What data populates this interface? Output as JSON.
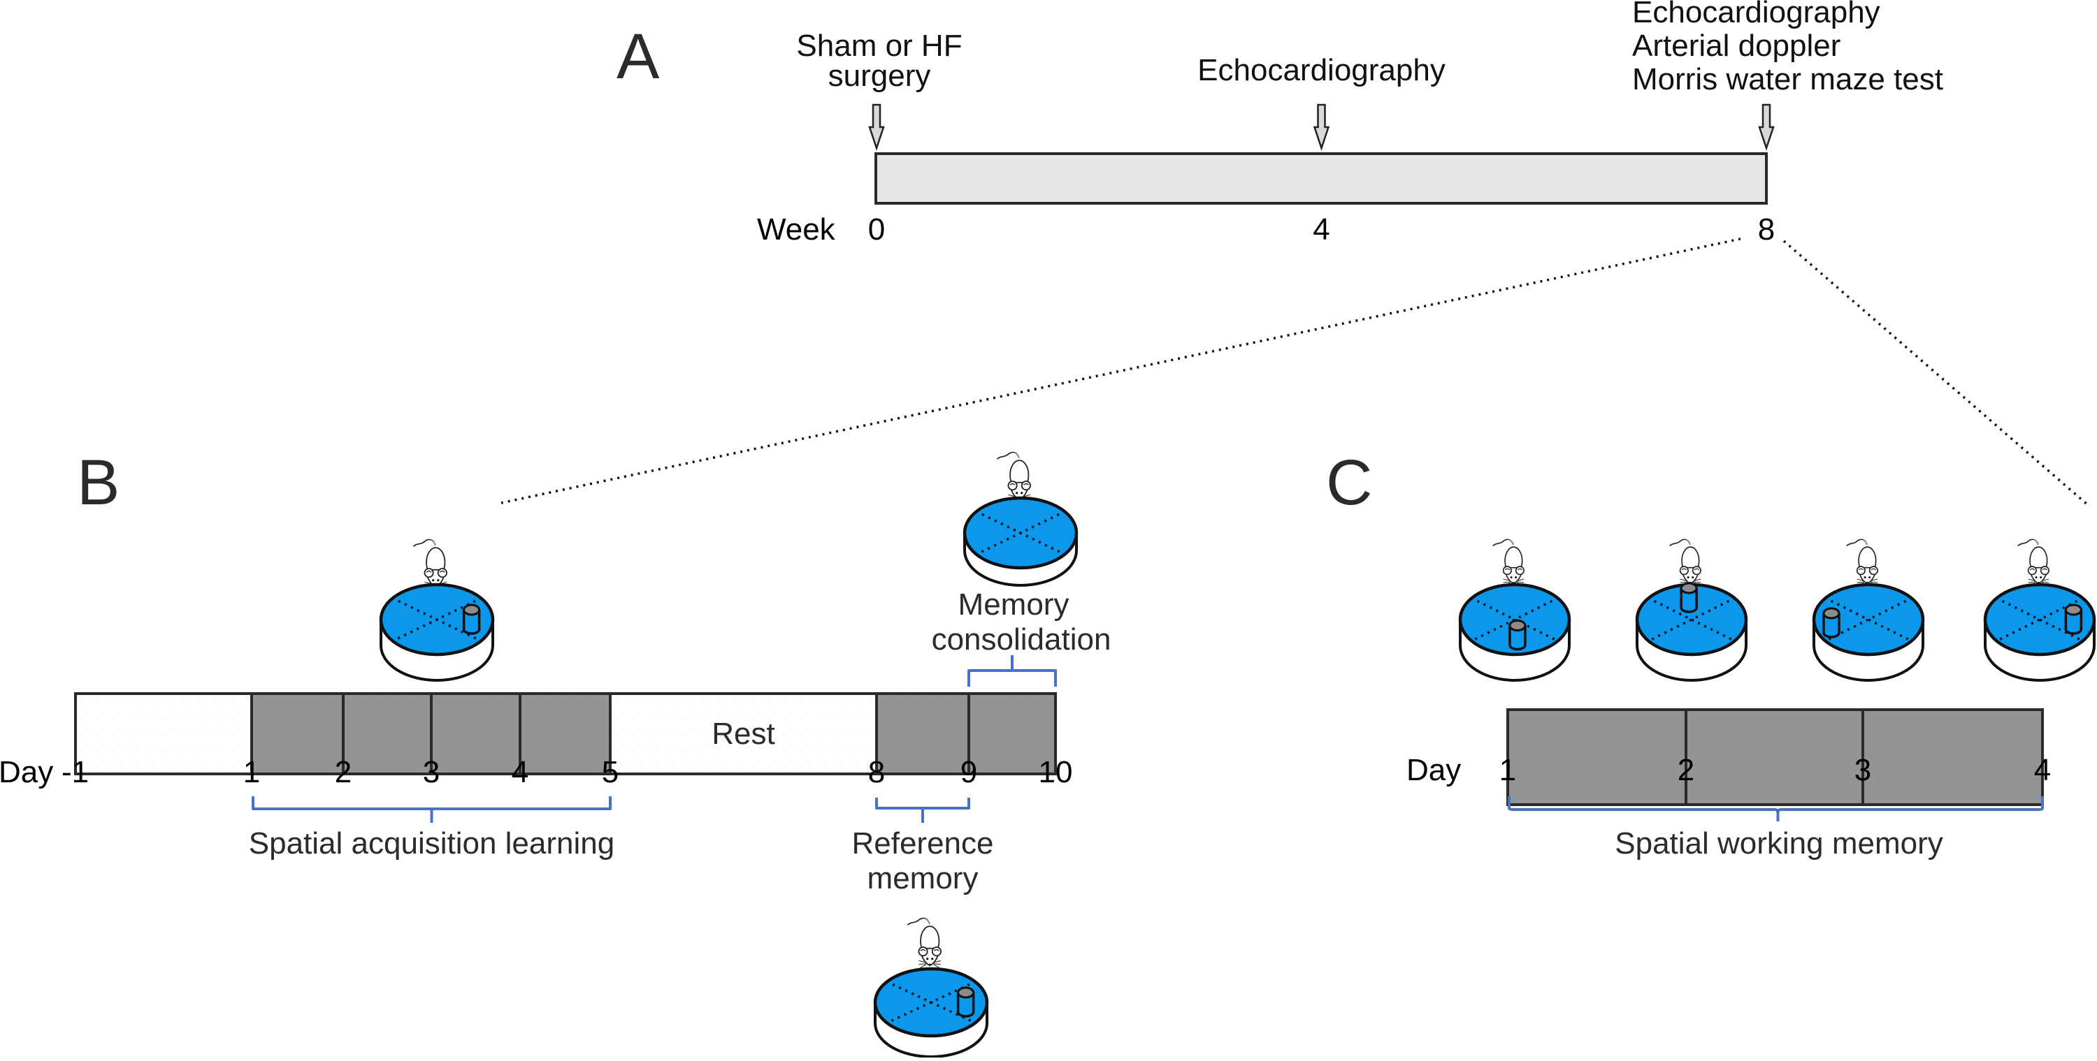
{
  "colors": {
    "pool_water": "#0a97ec",
    "platform_top": "#8c8c8c",
    "bar_timeline": "#e6e7e9",
    "bar_active": "#939495",
    "bar_rest": "#ffffff",
    "bracket": "#4a72c4",
    "arrow_fill": "#d9d9d9"
  },
  "panelA": {
    "letter": "A",
    "axis_label": "Week",
    "ticks": [
      "0",
      "4",
      "8"
    ],
    "events": [
      {
        "week": 0,
        "lines": [
          "Sham or HF",
          "surgery"
        ]
      },
      {
        "week": 4,
        "lines": [
          "Echocardiography"
        ]
      },
      {
        "week": 8,
        "lines": [
          "Echocardiography",
          "Arterial doppler",
          "Morris water maze test"
        ]
      }
    ]
  },
  "panelB": {
    "letter": "B",
    "axis_label": "Day",
    "ticks": [
      "-1",
      "1",
      "2",
      "3",
      "4",
      "5",
      "8",
      "9",
      "10"
    ],
    "segments": [
      {
        "from": "-1",
        "to": "1",
        "kind": "rest",
        "label": ""
      },
      {
        "from": "1",
        "to": "2",
        "kind": "active",
        "label": ""
      },
      {
        "from": "2",
        "to": "3",
        "kind": "active",
        "label": ""
      },
      {
        "from": "3",
        "to": "4",
        "kind": "active",
        "label": ""
      },
      {
        "from": "4",
        "to": "5",
        "kind": "active",
        "label": ""
      },
      {
        "from": "5",
        "to": "8",
        "kind": "rest",
        "label": "Rest"
      },
      {
        "from": "8",
        "to": "9",
        "kind": "active",
        "label": ""
      },
      {
        "from": "9",
        "to": "10",
        "kind": "active",
        "label": ""
      }
    ],
    "rest_label": "Rest",
    "brackets": [
      {
        "name": "spatial-acquisition-learning",
        "from": "1",
        "to": "5",
        "position": "below",
        "lines": [
          "Spatial acquisition learning"
        ]
      },
      {
        "name": "reference-memory",
        "from": "8",
        "to": "9",
        "position": "below",
        "lines": [
          "Reference",
          "memory"
        ]
      },
      {
        "name": "memory-consolidation",
        "from": "9",
        "to": "10",
        "position": "above",
        "lines": [
          "Memory",
          "consolidation"
        ]
      }
    ],
    "pools": [
      {
        "name": "acquisition",
        "platform": "east"
      },
      {
        "name": "consolidation",
        "platform": "none"
      },
      {
        "name": "reference",
        "platform": "east"
      }
    ]
  },
  "panelC": {
    "letter": "C",
    "axis_label": "Day",
    "ticks": [
      "1",
      "2",
      "3",
      "4"
    ],
    "bracket": {
      "from": "1",
      "to": "4",
      "lines": [
        "Spatial working memory"
      ]
    },
    "pools": [
      {
        "day": "1",
        "platform": "south"
      },
      {
        "day": "2",
        "platform": "north"
      },
      {
        "day": "3",
        "platform": "west"
      },
      {
        "day": "4",
        "platform": "east"
      }
    ]
  },
  "icons": {
    "mouse": "mouse-icon",
    "pool": "water-maze-pool-icon",
    "platform": "hidden-platform-icon",
    "arrow": "down-arrow-icon"
  }
}
